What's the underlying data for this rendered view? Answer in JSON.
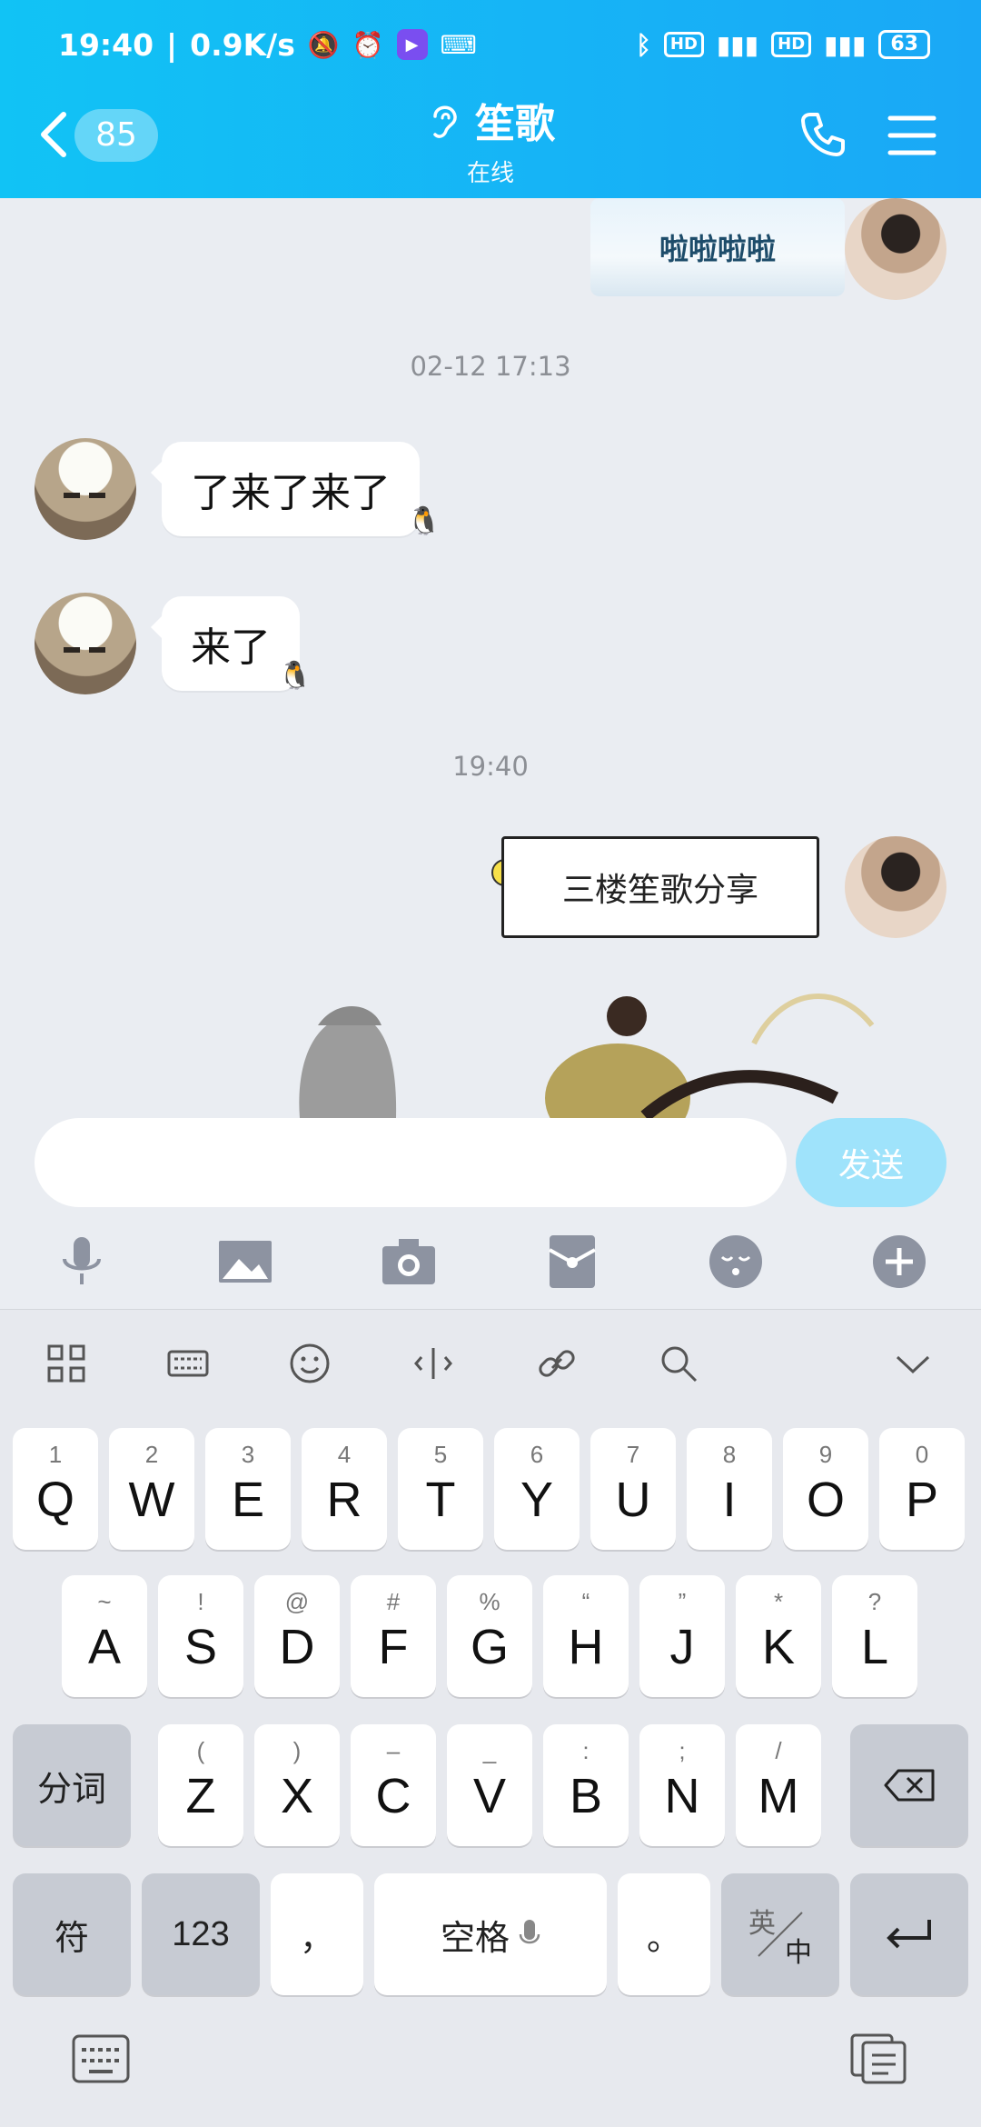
{
  "status_bar": {
    "time": "19:40",
    "speed": "0.9K/s",
    "battery": "63"
  },
  "header": {
    "unread_count": "85",
    "contact_name": "笙歌",
    "contact_status": "在线"
  },
  "messages": {
    "sticker_top_text": "啦啦啦啦",
    "time_1": "02-12 17:13",
    "msg_1": "了来了来了",
    "msg_2": "来了",
    "time_2": "19:40",
    "sticker_share_text": "三楼笙歌分享"
  },
  "input": {
    "placeholder": "",
    "send_label": "发送"
  },
  "icons": [
    "voice-icon",
    "image-icon",
    "camera-icon",
    "red-packet-icon",
    "emoji-icon",
    "plus-icon"
  ],
  "keyboard": {
    "row1": [
      {
        "main": "Q",
        "sub": "1"
      },
      {
        "main": "W",
        "sub": "2"
      },
      {
        "main": "E",
        "sub": "3"
      },
      {
        "main": "R",
        "sub": "4"
      },
      {
        "main": "T",
        "sub": "5"
      },
      {
        "main": "Y",
        "sub": "6"
      },
      {
        "main": "U",
        "sub": "7"
      },
      {
        "main": "I",
        "sub": "8"
      },
      {
        "main": "O",
        "sub": "9"
      },
      {
        "main": "P",
        "sub": "0"
      }
    ],
    "row2": [
      {
        "main": "A",
        "sub": "~"
      },
      {
        "main": "S",
        "sub": "!"
      },
      {
        "main": "D",
        "sub": "@"
      },
      {
        "main": "F",
        "sub": "#"
      },
      {
        "main": "G",
        "sub": "%"
      },
      {
        "main": "H",
        "sub": "“"
      },
      {
        "main": "J",
        "sub": "”"
      },
      {
        "main": "K",
        "sub": "*"
      },
      {
        "main": "L",
        "sub": "?"
      }
    ],
    "row3": [
      {
        "main": "Z",
        "sub": "("
      },
      {
        "main": "X",
        "sub": ")"
      },
      {
        "main": "C",
        "sub": "–"
      },
      {
        "main": "V",
        "sub": "_"
      },
      {
        "main": "B",
        "sub": ":"
      },
      {
        "main": "N",
        "sub": ";"
      },
      {
        "main": "M",
        "sub": "/"
      }
    ],
    "segment_label": "分词",
    "symbol_label": "符",
    "num_label": "123",
    "comma": "，",
    "space_label": "空格",
    "period": "。",
    "lang_top": "英",
    "lang_bottom": "中"
  },
  "colors": {
    "header_start": "#11c3f5",
    "header_end": "#1aa8f6",
    "send_button": "#9fe3fb",
    "chat_bg": "#eaedf2"
  }
}
